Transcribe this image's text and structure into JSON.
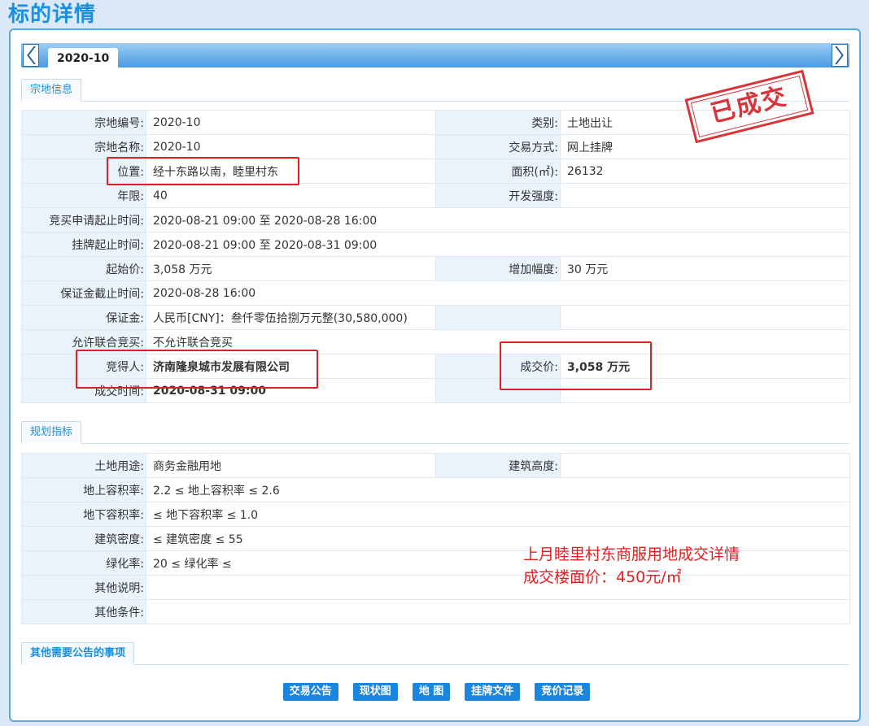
{
  "page": {
    "title": "标的详情"
  },
  "tabs": {
    "active": "2020-10"
  },
  "sections": {
    "land_info": "宗地信息",
    "planning": "规划指标",
    "other": "其他需要公告的事项"
  },
  "land_info": {
    "rows": [
      {
        "l1": "宗地编号:",
        "v1": "2020-10",
        "l2": "类别:",
        "v2": "土地出让"
      },
      {
        "l1": "宗地名称:",
        "v1": "2020-10",
        "l2": "交易方式:",
        "v2": "网上挂牌"
      },
      {
        "l1": "位置:",
        "v1": "经十东路以南，睦里村东",
        "l2": "面积(㎡):",
        "v2": "26132"
      },
      {
        "l1": "年限:",
        "v1": "40",
        "l2": "开发强度:",
        "v2": ""
      },
      {
        "l1": "竞买申请起止时间:",
        "v1": "2020-08-21 09:00 至 2020-08-28 16:00"
      },
      {
        "l1": "挂牌起止时间:",
        "v1": "2020-08-21 09:00 至 2020-08-31 09:00"
      },
      {
        "l1": "起始价:",
        "v1": "3,058 万元",
        "l2": "增加幅度:",
        "v2": "30 万元"
      },
      {
        "l1": "保证金截止时间:",
        "v1": "2020-08-28 16:00"
      },
      {
        "l1": "保证金:",
        "v1": "人民币[CNY]：叁仟零伍拾捌万元整(30,580,000)",
        "l2": "",
        "v2": ""
      },
      {
        "l1": "允许联合竞买:",
        "v1": "不允许联合竞买"
      },
      {
        "l1": "竞得人:",
        "v1": "济南隆泉城市发展有限公司",
        "l2": "成交价:",
        "v2": "3,058 万元"
      },
      {
        "l1": "成交时间:",
        "v1": "2020-08-31 09:00",
        "l2": "",
        "v2": ""
      }
    ]
  },
  "planning": {
    "rows": [
      {
        "l1": "土地用途:",
        "v1": "商务金融用地",
        "l2": "建筑高度:",
        "v2": ""
      },
      {
        "l1": "地上容积率:",
        "v1": "2.2 ≤ 地上容积率 ≤ 2.6"
      },
      {
        "l1": "地下容积率:",
        "v1": "≤ 地下容积率 ≤ 1.0"
      },
      {
        "l1": "建筑密度:",
        "v1": "≤ 建筑密度 ≤ 55"
      },
      {
        "l1": "绿化率:",
        "v1": "20 ≤ 绿化率 ≤"
      },
      {
        "l1": "其他说明:",
        "v1": ""
      },
      {
        "l1": "其他条件:",
        "v1": ""
      }
    ]
  },
  "stamp": "已成交",
  "note": {
    "line1": "上月睦里村东商服用地成交详情",
    "line2": "成交楼面价：450元/㎡"
  },
  "buttons": [
    "交易公告",
    "现状图",
    "地 图",
    "挂牌文件",
    "竞价记录"
  ],
  "colors": {
    "accent": "#1b8fe0",
    "highlight": "#e02020"
  }
}
